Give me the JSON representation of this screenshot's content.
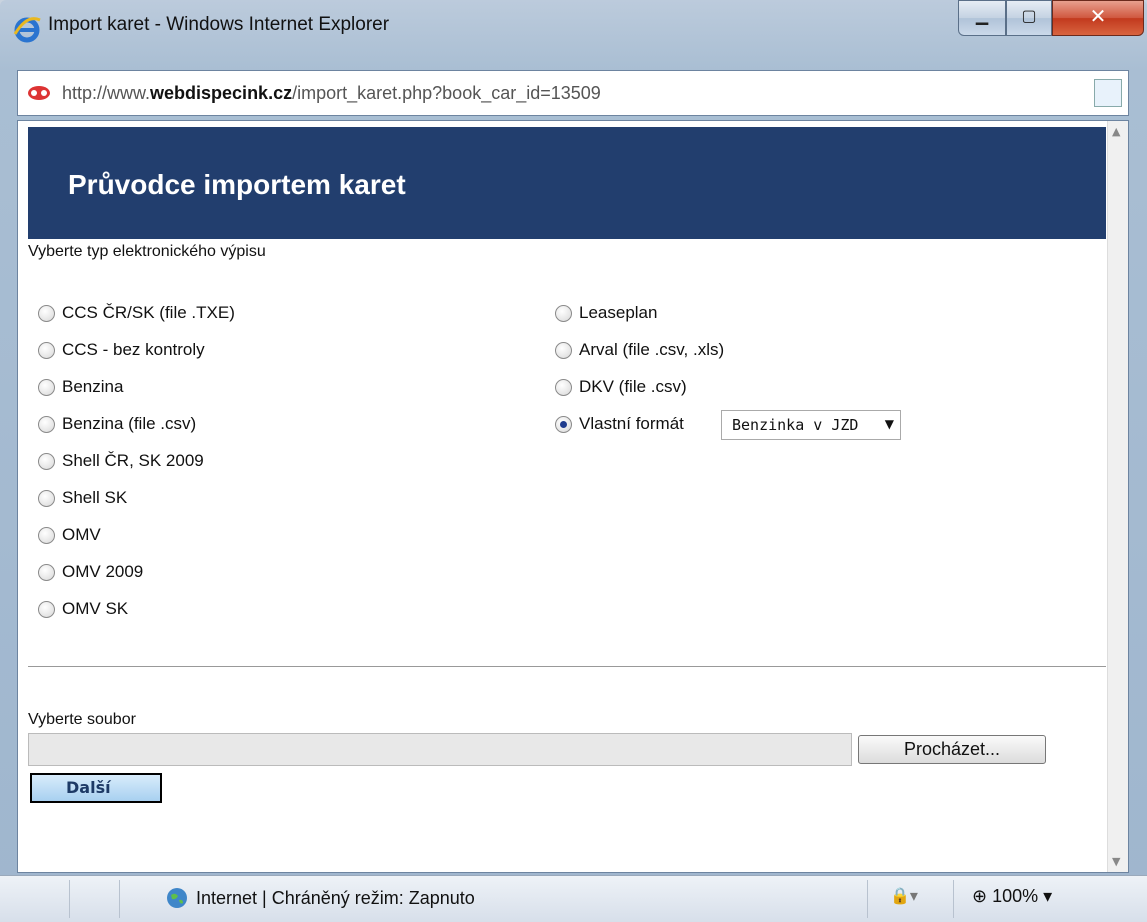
{
  "window": {
    "title": "Import karet - Windows Internet Explorer"
  },
  "address": {
    "prefix": "http://www.",
    "domain": "webdispecink.cz",
    "path": "/import_karet.php?book_car_id=13509"
  },
  "page": {
    "banner_title": "Průvodce importem karet",
    "type_label": "Vyberte typ elektronického výpisu",
    "left_options": [
      "CCS ČR/SK (file .TXE)",
      "CCS - bez kontroly",
      "Benzina",
      "Benzina (file .csv)",
      "Shell ČR, SK 2009",
      "Shell SK",
      "OMV",
      "OMV 2009",
      "OMV SK"
    ],
    "right_options": [
      "Leaseplan",
      "Arval (file .csv, .xls)",
      "DKV (file .csv)",
      "Vlastní formát"
    ],
    "selected_option": "Vlastní formát",
    "format_select_value": "Benzinka v JZD",
    "file_label": "Vyberte soubor",
    "browse_label": "Procházet...",
    "next_label": "Další"
  },
  "statusbar": {
    "zone_text": "Internet | Chráněný režim: Zapnuto",
    "zoom": "100%"
  }
}
